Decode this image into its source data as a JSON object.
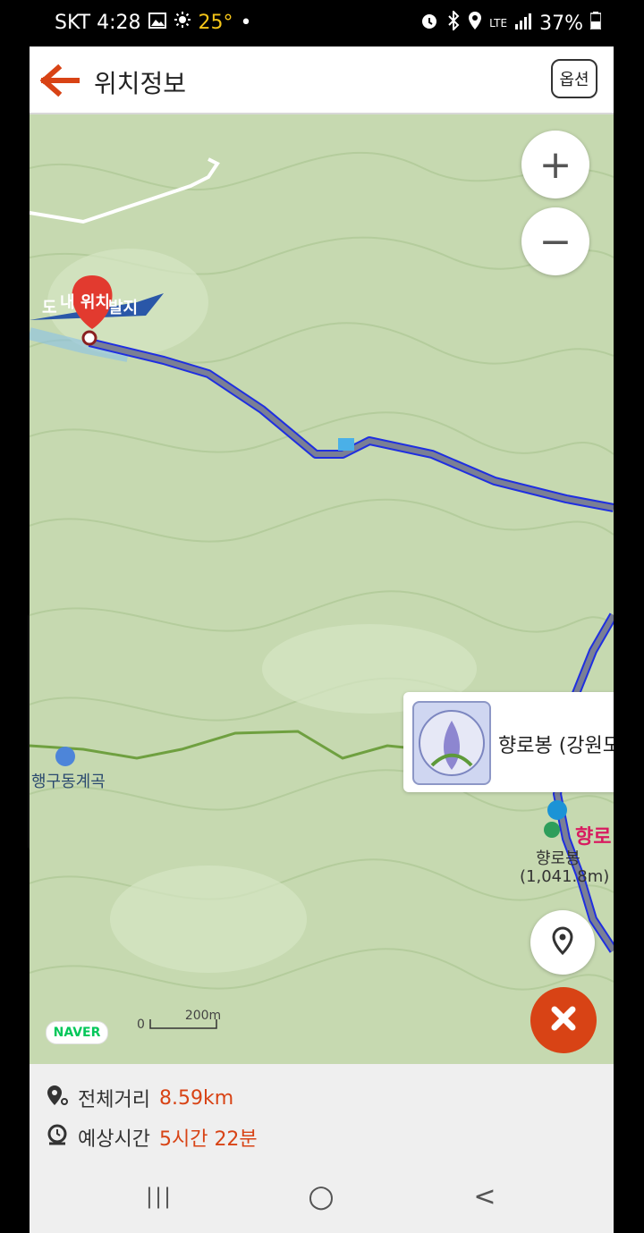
{
  "status_bar": {
    "carrier_time": "SKT 4:28",
    "temperature": "25°",
    "dot": "•",
    "network": "LTE",
    "battery": "37%"
  },
  "app_bar": {
    "title": "위치정보",
    "option_label": "옵션"
  },
  "map": {
    "my_location_label": "내 위치",
    "start_label_left": "도",
    "start_label_right": "발지",
    "valley_label": "행구동계곡",
    "peak_label": "향로",
    "peak_name": "향로봉",
    "peak_elevation": "(1,041.8m)",
    "popup_title": "향로봉 (강원도",
    "naver_logo": "NAVER",
    "scale_zero": "0",
    "scale_distance": "200m",
    "zoom_in": "+",
    "zoom_out": "−"
  },
  "info": {
    "distance_label": "전체거리",
    "distance_value": "8.59km",
    "time_label": "예상시간",
    "time_value": "5시간 22분"
  },
  "nav": {
    "recent": "|||",
    "home": "○",
    "back": "<"
  }
}
